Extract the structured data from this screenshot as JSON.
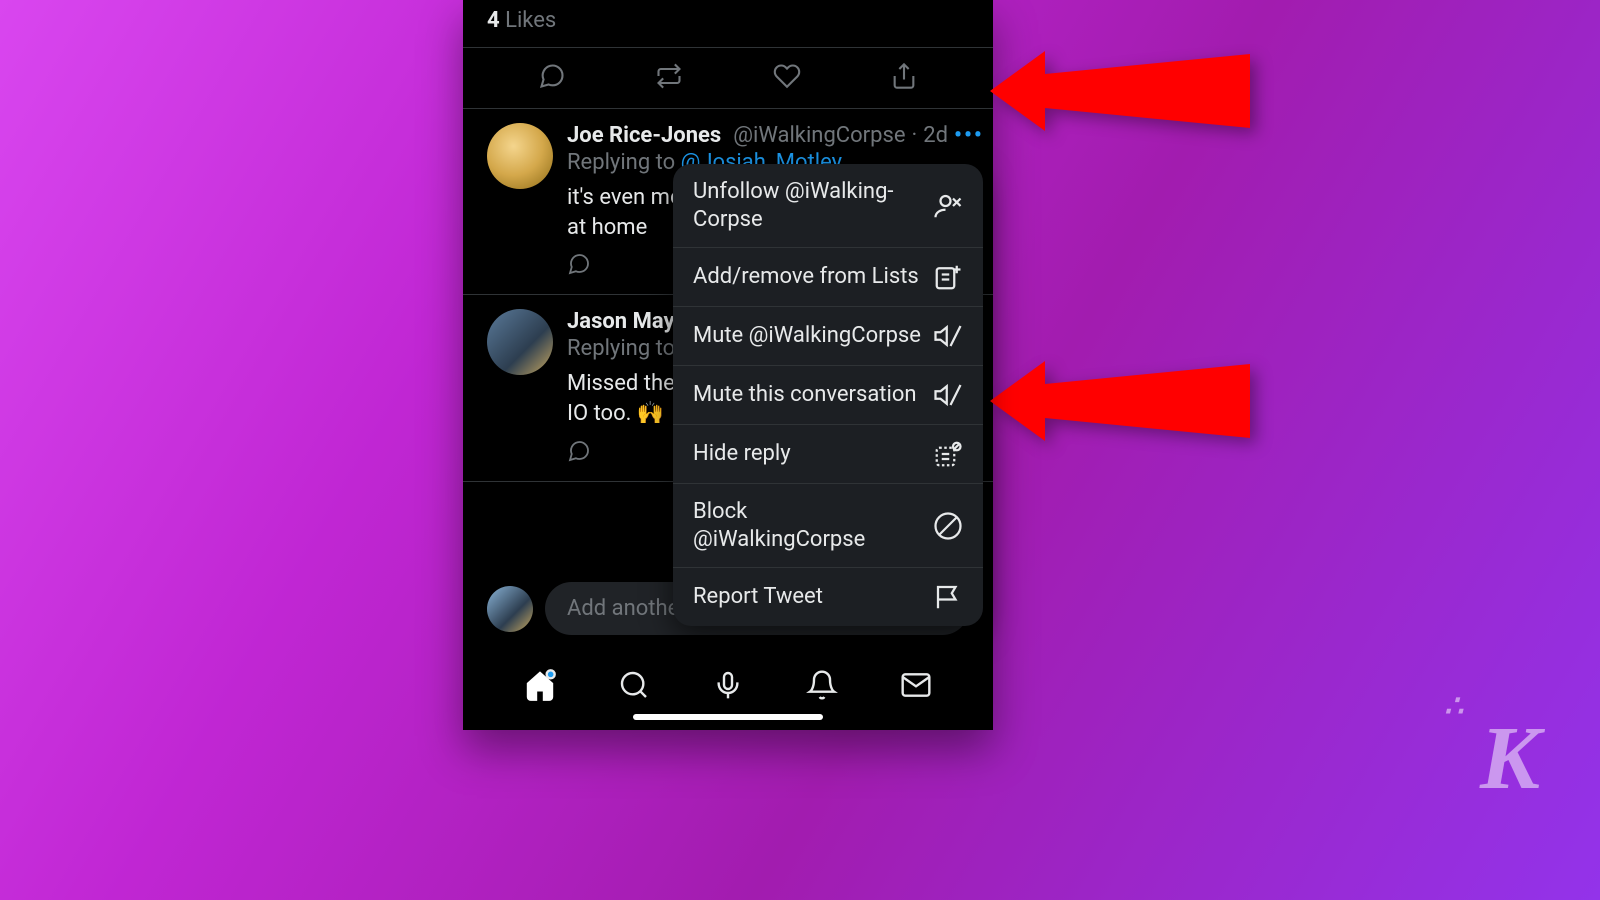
{
  "likes": {
    "count": "4",
    "label": "Likes"
  },
  "tweets": [
    {
      "display_name": "Joe Rice-Jones",
      "handle": "@iWalkingCorpse",
      "time": "2d",
      "replying_prefix": "Replying to ",
      "replying_to": "@Josiah_Motley",
      "text": "it's even mo\nat home"
    },
    {
      "display_name": "Jason Maye",
      "replying_prefix": "Replying to ",
      "replying_to": "@",
      "text": "Missed the p\nIO too. 🙌"
    }
  ],
  "menu": {
    "items": [
      {
        "label": "Unfollow @iWalking-Corpse",
        "icon": "unfollow"
      },
      {
        "label": "Add/remove from Lists",
        "icon": "list-add"
      },
      {
        "label": "Mute @iWalkingCorpse",
        "icon": "mute"
      },
      {
        "label": "Mute this conversation",
        "icon": "mute"
      },
      {
        "label": "Hide reply",
        "icon": "hide"
      },
      {
        "label": "Block @iWalkingCorpse",
        "icon": "block"
      },
      {
        "label": "Report Tweet",
        "icon": "flag"
      }
    ]
  },
  "compose": {
    "placeholder": "Add another Tweet"
  },
  "colors": {
    "accent": "#1d9bf0",
    "arrow": "#ff0000"
  }
}
